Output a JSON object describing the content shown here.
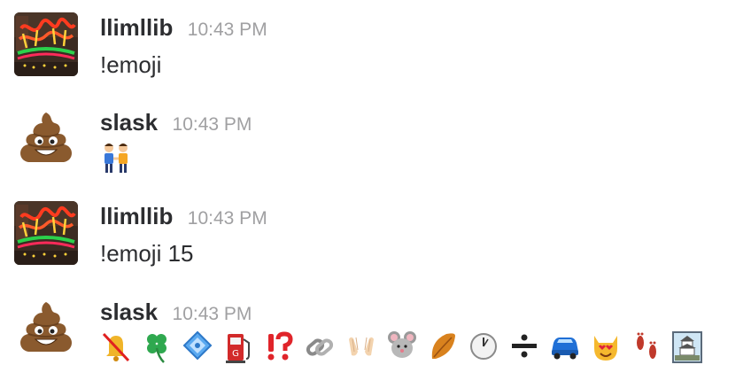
{
  "messages": [
    {
      "user": "llimllib",
      "time": "10:43 PM",
      "text": "!emoji",
      "avatar": "neon-sign-avatar"
    },
    {
      "user": "slask",
      "time": "10:43 PM",
      "emoji": [
        "two-men-holding-hands"
      ],
      "avatar": "pile-of-poo-avatar"
    },
    {
      "user": "llimllib",
      "time": "10:43 PM",
      "text": "!emoji 15",
      "avatar": "neon-sign-avatar"
    },
    {
      "user": "slask",
      "time": "10:43 PM",
      "avatar": "pile-of-poo-avatar",
      "emoji": [
        "bell-with-slash",
        "four-leaf-clover",
        "diamond-with-dot",
        "fuel-pump",
        "exclamation-question-mark",
        "link",
        "open-hands",
        "mouse-face",
        "fallen-leaf",
        "clock-one",
        "heavy-division-sign",
        "automobile",
        "smiling-cat-heart-eyes",
        "footprints",
        "japanese-castle"
      ]
    }
  ],
  "colors": {
    "username": "#2c2d30",
    "timestamp": "#a0a0a2",
    "background": "#ffffff"
  }
}
